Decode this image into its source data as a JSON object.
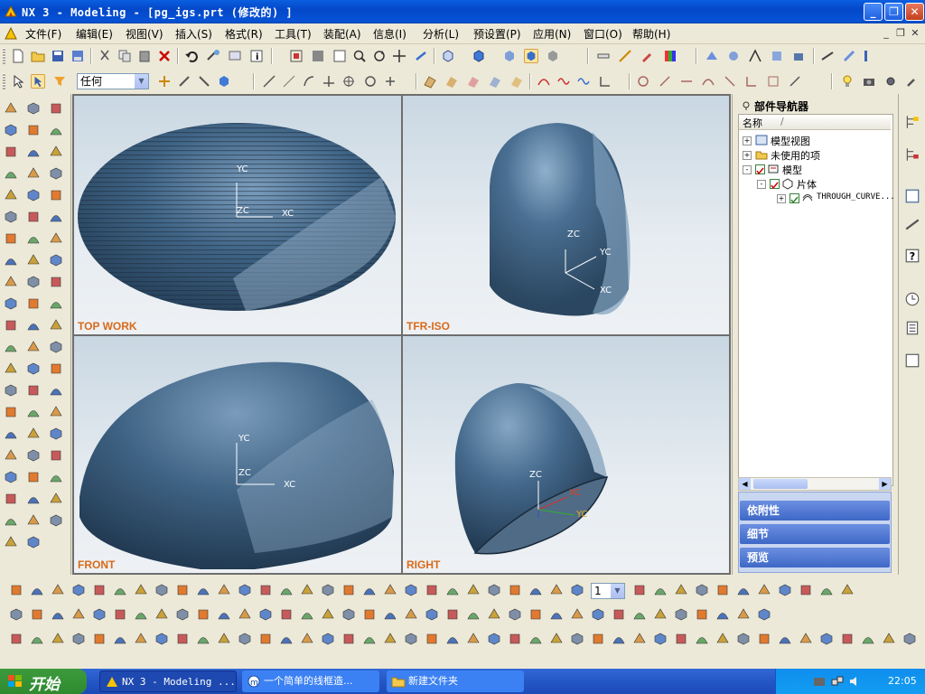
{
  "window": {
    "title": "NX 3 - Modeling - [pg_igs.prt  (修改的) ]"
  },
  "menus": [
    "文件(F)",
    "编辑(E)",
    "视图(V)",
    "插入(S)",
    "格式(R)",
    "工具(T)",
    "装配(A)",
    "信息(I)",
    "分析(L)",
    "预设置(P)",
    "应用(N)",
    "窗口(O)",
    "帮助(H)"
  ],
  "selection_filter": {
    "value": "任何"
  },
  "layer_combo": {
    "value": "1"
  },
  "viewports": {
    "top_left": {
      "label": "TOP WORK",
      "axes": [
        "YC",
        "ZC",
        "XC"
      ]
    },
    "top_right": {
      "label": "TFR-ISO",
      "axes": [
        "ZC",
        "YC",
        "XC"
      ]
    },
    "bottom_left": {
      "label": "FRONT",
      "axes": [
        "YC",
        "ZC",
        "XC"
      ]
    },
    "bottom_right": {
      "label": "RIGHT",
      "axes": [
        "ZC",
        "XC",
        "YC"
      ]
    }
  },
  "part_navigator": {
    "title": "部件导航器",
    "column": "名称",
    "nodes": [
      {
        "label": "模型视图",
        "level": 0,
        "expander": "+"
      },
      {
        "label": "未使用的项",
        "level": 0,
        "expander": "+"
      },
      {
        "label": "模型",
        "level": 0,
        "expander": "-"
      },
      {
        "label": "片体",
        "level": 1,
        "expander": "-"
      },
      {
        "label": "THROUGH_CURVE...",
        "level": 2,
        "expander": "+"
      }
    ],
    "sections": [
      "依附性",
      "细节",
      "预览"
    ]
  },
  "taskbar": {
    "start": "开始",
    "tasks": [
      "NX 3 - Modeling ...",
      "一个简单的线框造...",
      "新建文件夹"
    ],
    "clock": "22:05"
  },
  "colors": {
    "accent": "#0a5fe0",
    "surface": "#3d5d7e",
    "label": "#d86a1a"
  }
}
